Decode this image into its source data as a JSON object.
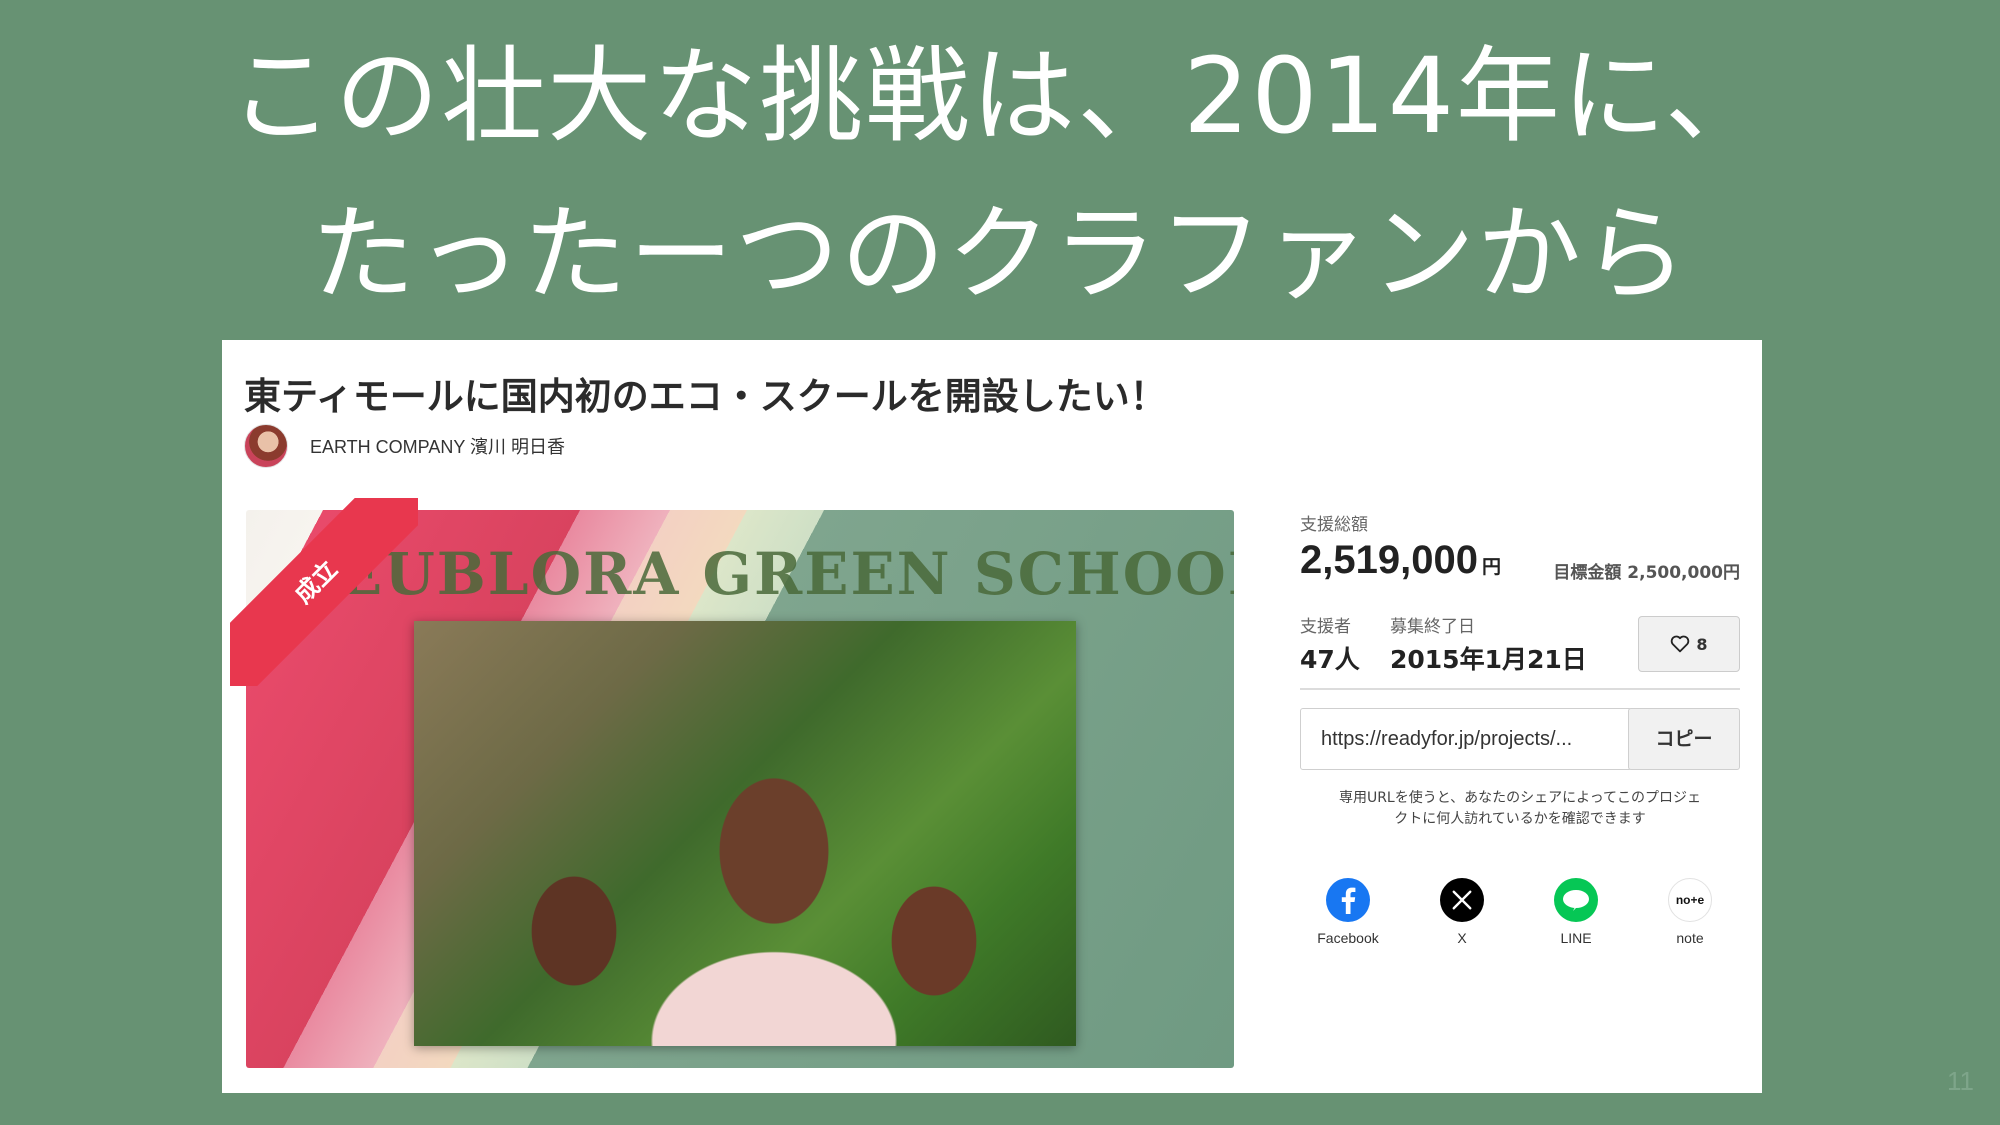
{
  "slide": {
    "title_line1": "この壮大な挑戦は、2014年に、",
    "title_line2": "たったーつのクラファンから",
    "page_number": "11"
  },
  "project": {
    "title": "東ティモールに国内初のエコ・スクールを開設したい！",
    "author": "EARTH COMPANY 濱川 明日香",
    "ribbon": "成立",
    "banner_text": "EUBLORA GREEN SCHOOL"
  },
  "stats": {
    "total_label": "支援総額",
    "total_value": "2,519,000",
    "yen": "円",
    "goal": "目標金額 2,500,000円",
    "supporters_label": "支援者",
    "supporters_value": "47人",
    "deadline_label": "募集終了日",
    "deadline_value": "2015年1月21日",
    "likes": "8"
  },
  "share": {
    "url": "https://readyfor.jp/projects/...",
    "copy_label": "コピー",
    "hint_line1": "専用URLを使うと、あなたのシェアによってこのプロジェ",
    "hint_line2": "クトに何人訪れているかを確認できます",
    "buttons": [
      {
        "label": "Facebook",
        "icon": "facebook-icon",
        "color": "#1877f2"
      },
      {
        "label": "X",
        "icon": "x-icon",
        "color": "#000000"
      },
      {
        "label": "LINE",
        "icon": "line-icon",
        "color": "#06c755"
      },
      {
        "label": "note",
        "icon": "note-icon",
        "color": "#ffffff"
      }
    ],
    "note_icon_text": "no+e"
  },
  "colors": {
    "background": "#679273",
    "ribbon": "#e8374e"
  }
}
